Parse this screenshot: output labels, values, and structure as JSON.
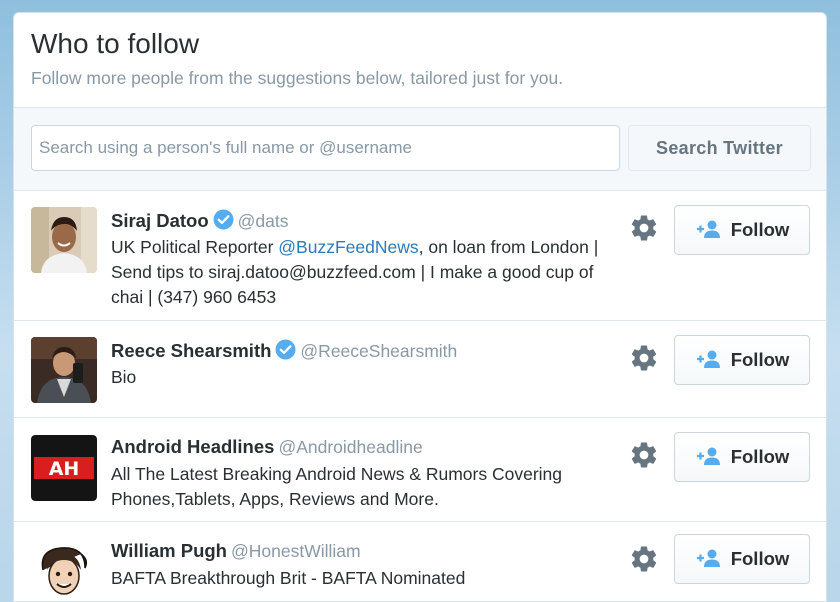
{
  "header": {
    "title": "Who to follow",
    "subtitle": "Follow more people from the suggestions below, tailored just for you."
  },
  "search": {
    "placeholder": "Search using a person's full name or @username",
    "button_label": "Search Twitter"
  },
  "colors": {
    "link": "#2b7bb9",
    "verified": "#55acee",
    "follow_icon": "#55acee",
    "muted": "#8899a6"
  },
  "users": [
    {
      "name": "Siraj Datoo",
      "verified": true,
      "handle": "@dats",
      "bio_before": "UK Political Reporter ",
      "bio_mention": "@BuzzFeedNews",
      "bio_after": ", on loan from London | Send tips to siraj.datoo@buzzfeed.com | I make a good cup of chai | (347) 960 6453",
      "follow_label": "Follow",
      "avatar_icon": "user-photo-avatar"
    },
    {
      "name": "Reece Shearsmith",
      "verified": true,
      "handle": "@ReeceShearsmith",
      "bio_before": "Bio",
      "follow_label": "Follow",
      "avatar_icon": "user-photo-avatar"
    },
    {
      "name": "Android Headlines",
      "verified": false,
      "handle": "@Androidheadline",
      "bio_before": "All The Latest Breaking Android News & Rumors Covering Phones,Tablets, Apps, Reviews and More.",
      "follow_label": "Follow",
      "avatar_text": "AH"
    },
    {
      "name": "William Pugh",
      "verified": false,
      "handle": "@HonestWilliam",
      "bio_before": "BAFTA Breakthrough Brit - BAFTA Nominated",
      "follow_label": "Follow",
      "avatar_icon": "cartoon-avatar"
    }
  ]
}
